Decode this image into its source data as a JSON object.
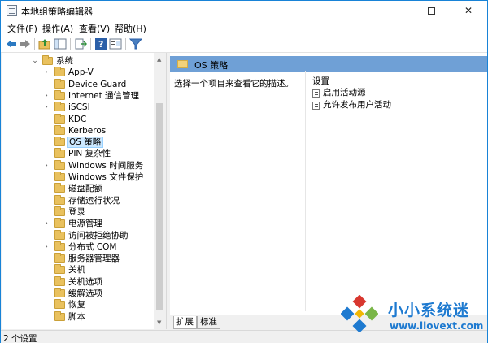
{
  "window": {
    "title": "本地组策略编辑器",
    "minimize_label": "",
    "maximize_label": "",
    "close_label": "✕"
  },
  "menubar": {
    "items": [
      "文件(F)",
      "操作(A)",
      "查看(V)",
      "帮助(H)"
    ]
  },
  "toolbar": {
    "icons": [
      "back-arrow-icon",
      "forward-arrow-icon",
      "up-folder-icon",
      "show-hide-tree-icon",
      "export-list-icon",
      "help-icon",
      "properties-icon",
      "filter-icon"
    ]
  },
  "tree": {
    "items": [
      {
        "label": "系统",
        "expanded": true,
        "chevron": "⌄"
      },
      {
        "label": "App-V",
        "chevron": "›"
      },
      {
        "label": "Device Guard",
        "chevron": ""
      },
      {
        "label": "Internet 通信管理",
        "chevron": "›"
      },
      {
        "label": "iSCSI",
        "chevron": "›"
      },
      {
        "label": "KDC",
        "chevron": ""
      },
      {
        "label": "Kerberos",
        "chevron": ""
      },
      {
        "label": "OS 策略",
        "chevron": "",
        "selected": true
      },
      {
        "label": "PIN 复杂性",
        "chevron": ""
      },
      {
        "label": "Windows 时间服务",
        "chevron": "›"
      },
      {
        "label": "Windows 文件保护",
        "chevron": ""
      },
      {
        "label": "磁盘配额",
        "chevron": ""
      },
      {
        "label": "存储运行状况",
        "chevron": ""
      },
      {
        "label": "登录",
        "chevron": ""
      },
      {
        "label": "电源管理",
        "chevron": "›"
      },
      {
        "label": "访问被拒绝协助",
        "chevron": ""
      },
      {
        "label": "分布式 COM",
        "chevron": "›"
      },
      {
        "label": "服务器管理器",
        "chevron": ""
      },
      {
        "label": "关机",
        "chevron": ""
      },
      {
        "label": "关机选项",
        "chevron": ""
      },
      {
        "label": "缓解选项",
        "chevron": ""
      },
      {
        "label": "恢复",
        "chevron": ""
      },
      {
        "label": "脚本",
        "chevron": ""
      }
    ]
  },
  "details": {
    "header_title": "OS 策略",
    "description": "选择一个项目来查看它的描述。",
    "settings_column": "设置",
    "settings": [
      "启用活动源",
      "允许发布用户活动"
    ]
  },
  "tabs": [
    "扩展",
    "标准"
  ],
  "statusbar": {
    "text": "2 个设置"
  },
  "watermark": {
    "title": "小小系统迷",
    "url": "www.ilovext.com"
  },
  "colors": {
    "header_blue": "#6fa0d6",
    "selection": "#cce8ff",
    "folder": "#e9c15e",
    "watermark_blue": "#1e7ad0"
  }
}
